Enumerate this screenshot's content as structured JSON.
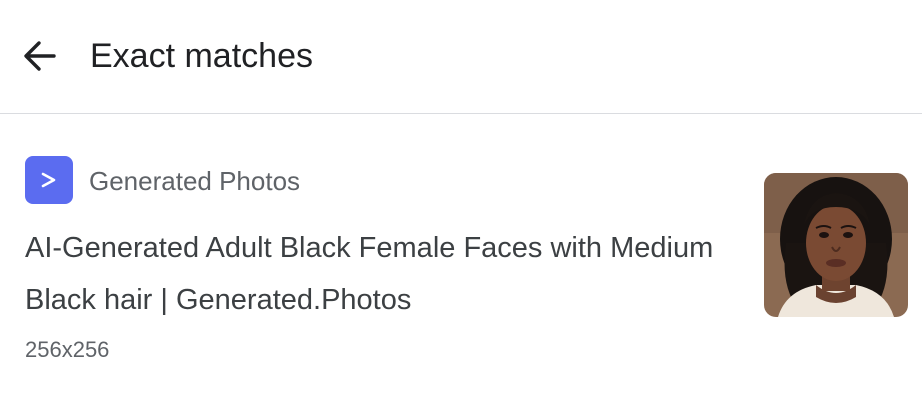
{
  "header": {
    "back_icon": "arrow-left-icon",
    "title": "Exact matches"
  },
  "result": {
    "favicon_icon": "chevron-right-icon",
    "favicon_color": "#5b6cf0",
    "source_name": "Generated Photos",
    "title": "AI-Generated Adult Black Female Faces with Medium Black hair | Generated.Photos",
    "dimensions": "256x256",
    "thumbnail": "face-portrait-image"
  }
}
